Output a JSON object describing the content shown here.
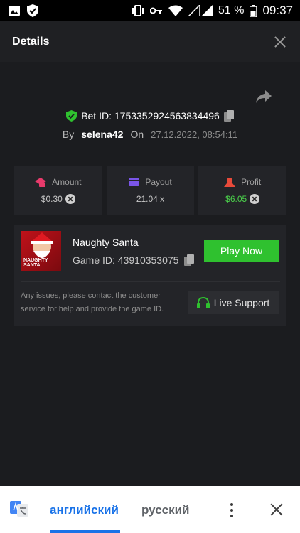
{
  "status_bar": {
    "battery": "51 %",
    "time": "09:37",
    "icons": [
      "image-icon",
      "shield-icon",
      "vibrate-icon",
      "key-icon",
      "wifi-icon",
      "signal-icon",
      "battery-icon"
    ]
  },
  "header": {
    "title": "Details"
  },
  "bet": {
    "id_label": "Bet ID: 1753352924563834496",
    "by_label": "By",
    "user": "selena42",
    "on_label": "On",
    "date": "27.12.2022, 08:54:11"
  },
  "stats": [
    {
      "label": "Amount",
      "value": "$0.30",
      "color": "#e83a6b"
    },
    {
      "label": "Payout",
      "value": "21.04 x",
      "color": "#7a55e8"
    },
    {
      "label": "Profit",
      "value": "$6.05",
      "color": "#e84a3a"
    }
  ],
  "game": {
    "name": "Naughty Santa",
    "id_label": "Game ID: 43910353075",
    "thumb_text": "NAUGHTY SANTA",
    "play_label": "Play Now",
    "support_text": "Any issues, please contact the customer service for help and provide the game ID.",
    "support_label": "Live Support"
  },
  "translate_bar": {
    "lang_active": "английский",
    "lang_other": "русский"
  },
  "colors": {
    "accent_green": "#2fc12f",
    "profit_green": "#4bd14b",
    "translate_blue": "#1a73e8"
  }
}
